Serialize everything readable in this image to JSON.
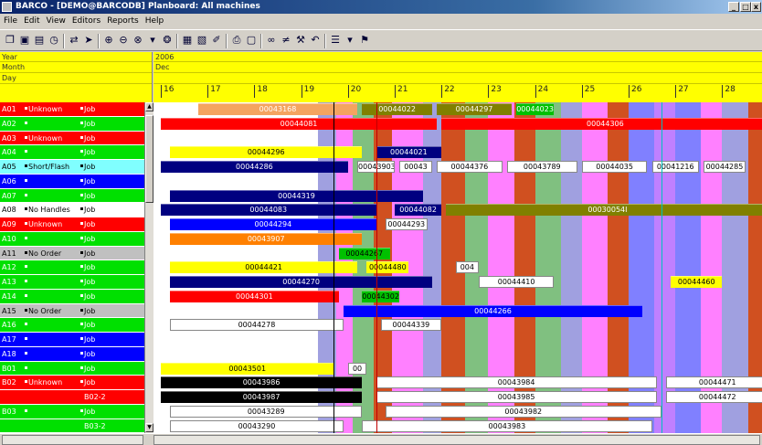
{
  "window": {
    "title": "BARCO - [DEMO@BARCODB] Planboard: All machines"
  },
  "menu": [
    "File",
    "Edit",
    "View",
    "Editors",
    "Reports",
    "Help"
  ],
  "toolbar": [
    "open-icon",
    "save-icon",
    "print-icon",
    "clock-icon",
    "move-icon",
    "arrow-icon",
    "zoom-in-icon",
    "zoom-out-icon",
    "zoom-fit-icon",
    "zoom-menu-icon",
    "binoculars-icon",
    "grid-icon",
    "chart-icon",
    "paint-icon",
    "printer-icon",
    "preview-icon",
    "link-icon",
    "split-icon",
    "tool-icon",
    "undo-icon",
    "list-icon",
    "list-menu-icon",
    "filter-icon"
  ],
  "header": {
    "year_label": "Year",
    "month_label": "Month",
    "day_label": "Day",
    "year": "2006",
    "month": "Dec",
    "days": [
      "16",
      "17",
      "18",
      "19",
      "20",
      "21",
      "22",
      "23",
      "24",
      "25",
      "26",
      "27",
      "28"
    ]
  },
  "rows": [
    {
      "id": "A01",
      "status": "Unknown",
      "kind": "Job",
      "color": "#ff0000"
    },
    {
      "id": "A02",
      "status": "",
      "kind": "Job",
      "color": "#00e000"
    },
    {
      "id": "A03",
      "status": "Unknown",
      "kind": "Job",
      "color": "#ff0000"
    },
    {
      "id": "A04",
      "status": "",
      "kind": "Job",
      "color": "#00e000"
    },
    {
      "id": "A05",
      "status": "Short/Flash",
      "kind": "Job",
      "color": "#80ffff"
    },
    {
      "id": "A06",
      "status": "",
      "kind": "Job",
      "color": "#0000ff"
    },
    {
      "id": "A07",
      "status": "",
      "kind": "Job",
      "color": "#00e000"
    },
    {
      "id": "A08",
      "status": "No Handles",
      "kind": "Job",
      "color": "#ffffff"
    },
    {
      "id": "A09",
      "status": "Unknown",
      "kind": "Job",
      "color": "#ff0000"
    },
    {
      "id": "A10",
      "status": "",
      "kind": "Job",
      "color": "#00e000"
    },
    {
      "id": "A11",
      "status": "No Order",
      "kind": "Job",
      "color": "#c0c0c0"
    },
    {
      "id": "A12",
      "status": "",
      "kind": "Job",
      "color": "#00e000"
    },
    {
      "id": "A13",
      "status": "",
      "kind": "Job",
      "color": "#00e000"
    },
    {
      "id": "A14",
      "status": "",
      "kind": "Job",
      "color": "#00e000"
    },
    {
      "id": "A15",
      "status": "No Order",
      "kind": "Job",
      "color": "#c0c0c0"
    },
    {
      "id": "A16",
      "status": "",
      "kind": "Job",
      "color": "#00e000"
    },
    {
      "id": "A17",
      "status": "",
      "kind": "Job",
      "color": "#0000ff"
    },
    {
      "id": "A18",
      "status": "",
      "kind": "Job",
      "color": "#0000ff"
    },
    {
      "id": "B01",
      "status": "",
      "kind": "Job",
      "color": "#00e000"
    },
    {
      "id": "B02",
      "status": "Unknown",
      "kind": "Job",
      "color": "#ff0000"
    },
    {
      "id": "",
      "status": "",
      "kind": "B02-2",
      "color": "#ff0000"
    },
    {
      "id": "B03",
      "status": "",
      "kind": "Job",
      "color": "#00e000"
    },
    {
      "id": "",
      "status": "",
      "kind": "B03-2",
      "color": "#00e000"
    }
  ],
  "bars": [
    {
      "row": 0,
      "start": 0.8,
      "end": 4.2,
      "color": "#f4a460",
      "text": "00043168",
      "tc": "#fff"
    },
    {
      "row": 0,
      "start": 4.3,
      "end": 5.8,
      "color": "#808000",
      "text": "00044022",
      "tc": "#fff"
    },
    {
      "row": 0,
      "start": 5.9,
      "end": 7.5,
      "color": "#808000",
      "text": "00044297",
      "tc": "#fff"
    },
    {
      "row": 0,
      "start": 7.6,
      "end": 8.4,
      "color": "#00c000",
      "text": "00044023",
      "tc": "#fff"
    },
    {
      "row": 1,
      "start": 0,
      "end": 5.9,
      "color": "#ff0000",
      "text": "00044081",
      "tc": "#fff"
    },
    {
      "row": 1,
      "start": 6.0,
      "end": 13,
      "color": "#ff0000",
      "text": "00044306",
      "tc": "#fff"
    },
    {
      "row": 3,
      "start": 0.2,
      "end": 4.3,
      "color": "#ffff00",
      "text": "00044296",
      "tc": "#000"
    },
    {
      "row": 3,
      "start": 4.6,
      "end": 6.0,
      "color": "#000080",
      "text": "00044021",
      "tc": "#fff"
    },
    {
      "row": 4,
      "start": 0,
      "end": 4.0,
      "color": "#000080",
      "text": "00044286",
      "tc": "#fff"
    },
    {
      "row": 4,
      "start": 4.2,
      "end": 5.0,
      "color": "#ffffff",
      "text": "00043903",
      "tc": "#000"
    },
    {
      "row": 4,
      "start": 5.1,
      "end": 5.8,
      "color": "#ffffff",
      "text": "00043",
      "tc": "#000"
    },
    {
      "row": 4,
      "start": 5.9,
      "end": 7.3,
      "color": "#ffffff",
      "text": "00044376",
      "tc": "#000"
    },
    {
      "row": 4,
      "start": 7.4,
      "end": 8.9,
      "color": "#ffffff",
      "text": "00043789",
      "tc": "#000"
    },
    {
      "row": 4,
      "start": 9.0,
      "end": 10.4,
      "color": "#ffffff",
      "text": "00044035",
      "tc": "#000"
    },
    {
      "row": 4,
      "start": 10.5,
      "end": 11.5,
      "color": "#ffffff",
      "text": "00041216",
      "tc": "#000"
    },
    {
      "row": 4,
      "start": 11.6,
      "end": 12.5,
      "color": "#ffffff",
      "text": "00044285",
      "tc": "#000"
    },
    {
      "row": 6,
      "start": 0.2,
      "end": 5.6,
      "color": "#000080",
      "text": "00044319",
      "tc": "#fff"
    },
    {
      "row": 7,
      "start": 0,
      "end": 4.6,
      "color": "#000080",
      "text": "00044083",
      "tc": "#fff"
    },
    {
      "row": 7,
      "start": 5.0,
      "end": 6.0,
      "color": "#000080",
      "text": "00044082",
      "tc": "#fff"
    },
    {
      "row": 7,
      "start": 6.1,
      "end": 13,
      "color": "#808000",
      "text": "00030054I",
      "tc": "#fff"
    },
    {
      "row": 8,
      "start": 0.2,
      "end": 4.6,
      "color": "#0000ff",
      "text": "00044294",
      "tc": "#fff"
    },
    {
      "row": 8,
      "start": 4.8,
      "end": 5.7,
      "color": "#ffffff",
      "text": "00044293",
      "tc": "#000"
    },
    {
      "row": 9,
      "start": 0.2,
      "end": 4.3,
      "color": "#ff8000",
      "text": "00043907",
      "tc": "#fff"
    },
    {
      "row": 10,
      "start": 3.8,
      "end": 4.9,
      "color": "#00c000",
      "text": "00044267",
      "tc": "#000"
    },
    {
      "row": 11,
      "start": 0.2,
      "end": 4.2,
      "color": "#ffff00",
      "text": "00044421",
      "tc": "#000"
    },
    {
      "row": 11,
      "start": 4.4,
      "end": 5.3,
      "color": "#ffff00",
      "text": "00044480",
      "tc": "#000"
    },
    {
      "row": 11,
      "start": 6.3,
      "end": 6.8,
      "color": "#ffffff",
      "text": "004",
      "tc": "#000"
    },
    {
      "row": 12,
      "start": 0.2,
      "end": 5.8,
      "color": "#000080",
      "text": "00044270",
      "tc": "#fff"
    },
    {
      "row": 12,
      "start": 6.8,
      "end": 8.4,
      "color": "#ffffff",
      "text": "00044410",
      "tc": "#000"
    },
    {
      "row": 12,
      "start": 10.9,
      "end": 12.0,
      "color": "#ffff00",
      "text": "00044460",
      "tc": "#000"
    },
    {
      "row": 13,
      "start": 0.2,
      "end": 3.8,
      "color": "#ff0000",
      "text": "00044301",
      "tc": "#fff"
    },
    {
      "row": 13,
      "start": 4.3,
      "end": 5.1,
      "color": "#00c000",
      "text": "00044302",
      "tc": "#000"
    },
    {
      "row": 14,
      "start": 3.9,
      "end": 10.3,
      "color": "#0000ff",
      "text": "00044266",
      "tc": "#fff"
    },
    {
      "row": 15,
      "start": 0.2,
      "end": 3.9,
      "color": "#ffffff",
      "text": "00044278",
      "tc": "#000"
    },
    {
      "row": 15,
      "start": 4.7,
      "end": 6.0,
      "color": "#ffffff",
      "text": "00044339",
      "tc": "#000"
    },
    {
      "row": 18,
      "start": 0,
      "end": 3.7,
      "color": "#ffff00",
      "text": "00043501",
      "tc": "#000"
    },
    {
      "row": 18,
      "start": 4.0,
      "end": 4.4,
      "color": "#ffffff",
      "text": "00",
      "tc": "#000"
    },
    {
      "row": 19,
      "start": 0,
      "end": 4.3,
      "color": "#000000",
      "text": "00043986",
      "tc": "#fff"
    },
    {
      "row": 19,
      "start": 4.6,
      "end": 10.6,
      "color": "#ffffff",
      "text": "00043984",
      "tc": "#000"
    },
    {
      "row": 19,
      "start": 10.8,
      "end": 13,
      "color": "#ffffff",
      "text": "00044471",
      "tc": "#000"
    },
    {
      "row": 20,
      "start": 0,
      "end": 4.3,
      "color": "#000000",
      "text": "00043987",
      "tc": "#fff"
    },
    {
      "row": 20,
      "start": 4.6,
      "end": 10.6,
      "color": "#ffffff",
      "text": "00043985",
      "tc": "#000"
    },
    {
      "row": 20,
      "start": 10.8,
      "end": 13,
      "color": "#ffffff",
      "text": "00044472",
      "tc": "#000"
    },
    {
      "row": 21,
      "start": 0.2,
      "end": 4.3,
      "color": "#ffffff",
      "text": "00043289",
      "tc": "#000"
    },
    {
      "row": 21,
      "start": 4.8,
      "end": 10.7,
      "color": "#ffffff",
      "text": "00043982",
      "tc": "#000"
    },
    {
      "row": 22,
      "start": 0.2,
      "end": 3.9,
      "color": "#ffffff",
      "text": "00043290",
      "tc": "#000"
    },
    {
      "row": 22,
      "start": 4.3,
      "end": 10.5,
      "color": "#ffffff",
      "text": "00043983",
      "tc": "#000"
    }
  ],
  "colors": {
    "header": "#ffff00",
    "weekend": "#ff80ff",
    "slate": "#a0a0e0",
    "green": "#80c080",
    "rust": "#d05020",
    "blue": "#8080ff",
    "violet": "#c080ff"
  }
}
